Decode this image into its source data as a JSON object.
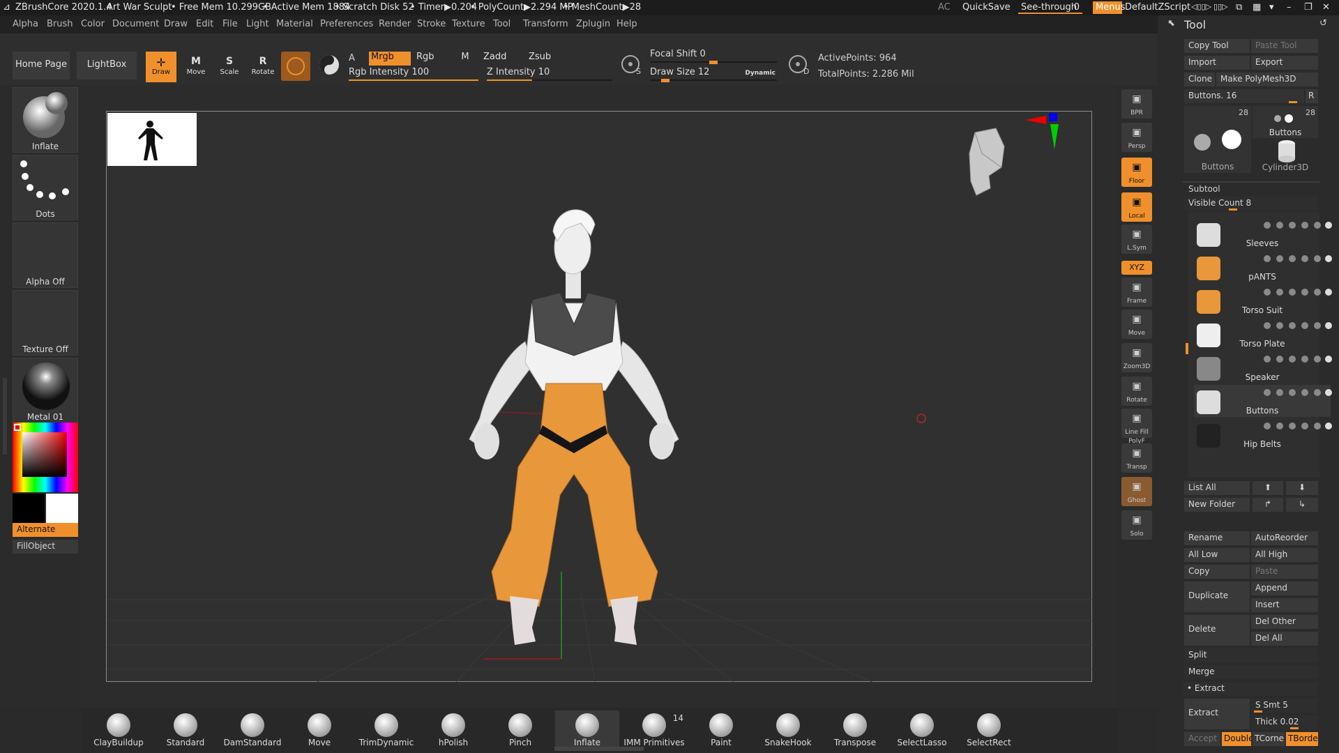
{
  "titlebar": {
    "app": "ZBrushCore 2020.1.4",
    "project": "Art War Sculpt",
    "free_mem": "• Free Mem 10.299GB",
    "active_mem": "• Active Mem 1884",
    "scratch": "• Scratch Disk 52",
    "timer": "• Timer▶0.204",
    "polycount": "• PolyCount▶2.294 MP",
    "meshcount": "• MeshCount▶28",
    "ac": "AC",
    "quicksave": "QuickSave",
    "seethrough": "See-through",
    "seethrough_value": "0",
    "menus": "Menus",
    "script": "DefaultZScript"
  },
  "menubar": [
    "Alpha",
    "Brush",
    "Color",
    "Document",
    "Draw",
    "Edit",
    "File",
    "Light",
    "Material",
    "Preferences",
    "Render",
    "Stroke",
    "Texture",
    "Tool",
    "Transform",
    "Zplugin",
    "Help"
  ],
  "toppanel": {
    "home_page": "Home Page",
    "lightbox": "LightBox",
    "modes": [
      {
        "label": "Draw",
        "key": "",
        "active": true
      },
      {
        "label": "Move",
        "key": "M",
        "active": false
      },
      {
        "label": "Scale",
        "key": "S",
        "active": false
      },
      {
        "label": "Rotate",
        "key": "R",
        "active": false
      }
    ],
    "a_label": "A",
    "mrgb": "Mrgb",
    "rgb": "Rgb",
    "m": "M",
    "zadd": "Zadd",
    "zsub": "Zsub",
    "rgb_intensity": "Rgb Intensity 100",
    "z_intensity": "Z Intensity 10",
    "rgb_intensity_level": 1.0,
    "z_intensity_level": 0.36,
    "focal_shift": "Focal Shift 0",
    "draw_size": "Draw Size 12",
    "focal_level": 0.5,
    "draw_size_level": 0.12,
    "dynamic": "Dynamic",
    "s_key": "S",
    "d_key": "D",
    "active_points": "ActivePoints: 964",
    "total_points": "TotalPoints: 2.286 Mil"
  },
  "leftshelf": {
    "brush": "Inflate",
    "stroke": "Dots",
    "alpha": "Alpha Off",
    "texture": "Texture Off",
    "material": "Metal 01",
    "alternate": "Alternate",
    "fillobject": "FillObject",
    "primary_color": "#000000",
    "secondary_color": "#ffffff"
  },
  "rightshelf": [
    {
      "label": "BPR",
      "icon": "bpr-icon",
      "on": false
    },
    {
      "label": "Persp",
      "icon": "persp-icon",
      "on": false
    },
    {
      "label": "Floor",
      "icon": "floor-icon",
      "on": true
    },
    {
      "label": "Local",
      "icon": "local-icon",
      "on": true
    },
    {
      "label": "L.Sym",
      "icon": "lsym-icon",
      "on": false
    },
    {
      "label": "XYZ",
      "icon": "xyz-icon",
      "on": true
    },
    {
      "label": "Frame",
      "icon": "frame-icon",
      "on": false
    },
    {
      "label": "Move",
      "icon": "move-hand-icon",
      "on": false
    },
    {
      "label": "Zoom3D",
      "icon": "zoom-icon",
      "on": false
    },
    {
      "label": "Rotate",
      "icon": "rotate-icon",
      "on": false
    },
    {
      "label": "Line Fill",
      "sublabel": "PolyF",
      "icon": "polyframe-icon",
      "on": false
    },
    {
      "label": "Transp",
      "icon": "transp-icon",
      "on": false
    },
    {
      "label": "Ghost",
      "icon": "ghost-icon",
      "on": false
    },
    {
      "label": "Solo",
      "icon": "solo-icon",
      "on": false
    }
  ],
  "bottomshelf": [
    {
      "label": "ClayBuildup"
    },
    {
      "label": "Standard"
    },
    {
      "label": "DamStandard"
    },
    {
      "label": "Move"
    },
    {
      "label": "TrimDynamic"
    },
    {
      "label": "hPolish"
    },
    {
      "label": "Pinch"
    },
    {
      "label": "Inflate"
    },
    {
      "label": "IMM Primitives",
      "count": "14"
    },
    {
      "label": "Paint"
    },
    {
      "label": "SnakeHook"
    },
    {
      "label": "Transpose"
    },
    {
      "label": "SelectLasso"
    },
    {
      "label": "SelectRect"
    }
  ],
  "toolpanel": {
    "title": "Tool",
    "copy_tool": "Copy Tool",
    "paste_tool": "Paste Tool",
    "import": "Import",
    "export": "Export",
    "clone": "Clone",
    "make_polymesh": "Make PolyMesh3D",
    "buttons_slider": "Buttons. 16",
    "r": "R",
    "thumb_count_a": "28",
    "thumb_count_b": "28",
    "thumb_label_a": "Buttons",
    "thumb_label_b": "Buttons",
    "thumb_label_c": "Cylinder3D",
    "subtool": "Subtool",
    "visible_count": "Visible Count 8",
    "subtools": [
      "Sleeves",
      "pANTS",
      "Torso Suit",
      "Torso Plate",
      "Speaker",
      "Buttons",
      "Hip Belts"
    ],
    "list_all": "List All",
    "new_folder": "New Folder",
    "rename": "Rename",
    "autoreorder": "AutoReorder",
    "all_low": "All Low",
    "all_high": "All High",
    "copy": "Copy",
    "paste": "Paste",
    "duplicate": "Duplicate",
    "append": "Append",
    "insert": "Insert",
    "delete": "Delete",
    "del_other": "Del Other",
    "del_all": "Del All",
    "split": "Split",
    "merge": "Merge",
    "extract_header": "• Extract",
    "extract": "Extract",
    "s_smt": "S Smt 5",
    "thick": "Thick 0.02",
    "accept": "Accept",
    "double": "Double",
    "tcorne": "TCorne",
    "tborde": "TBorde"
  },
  "colors": {
    "accent": "#f0902c",
    "pants": "#e8973a"
  }
}
